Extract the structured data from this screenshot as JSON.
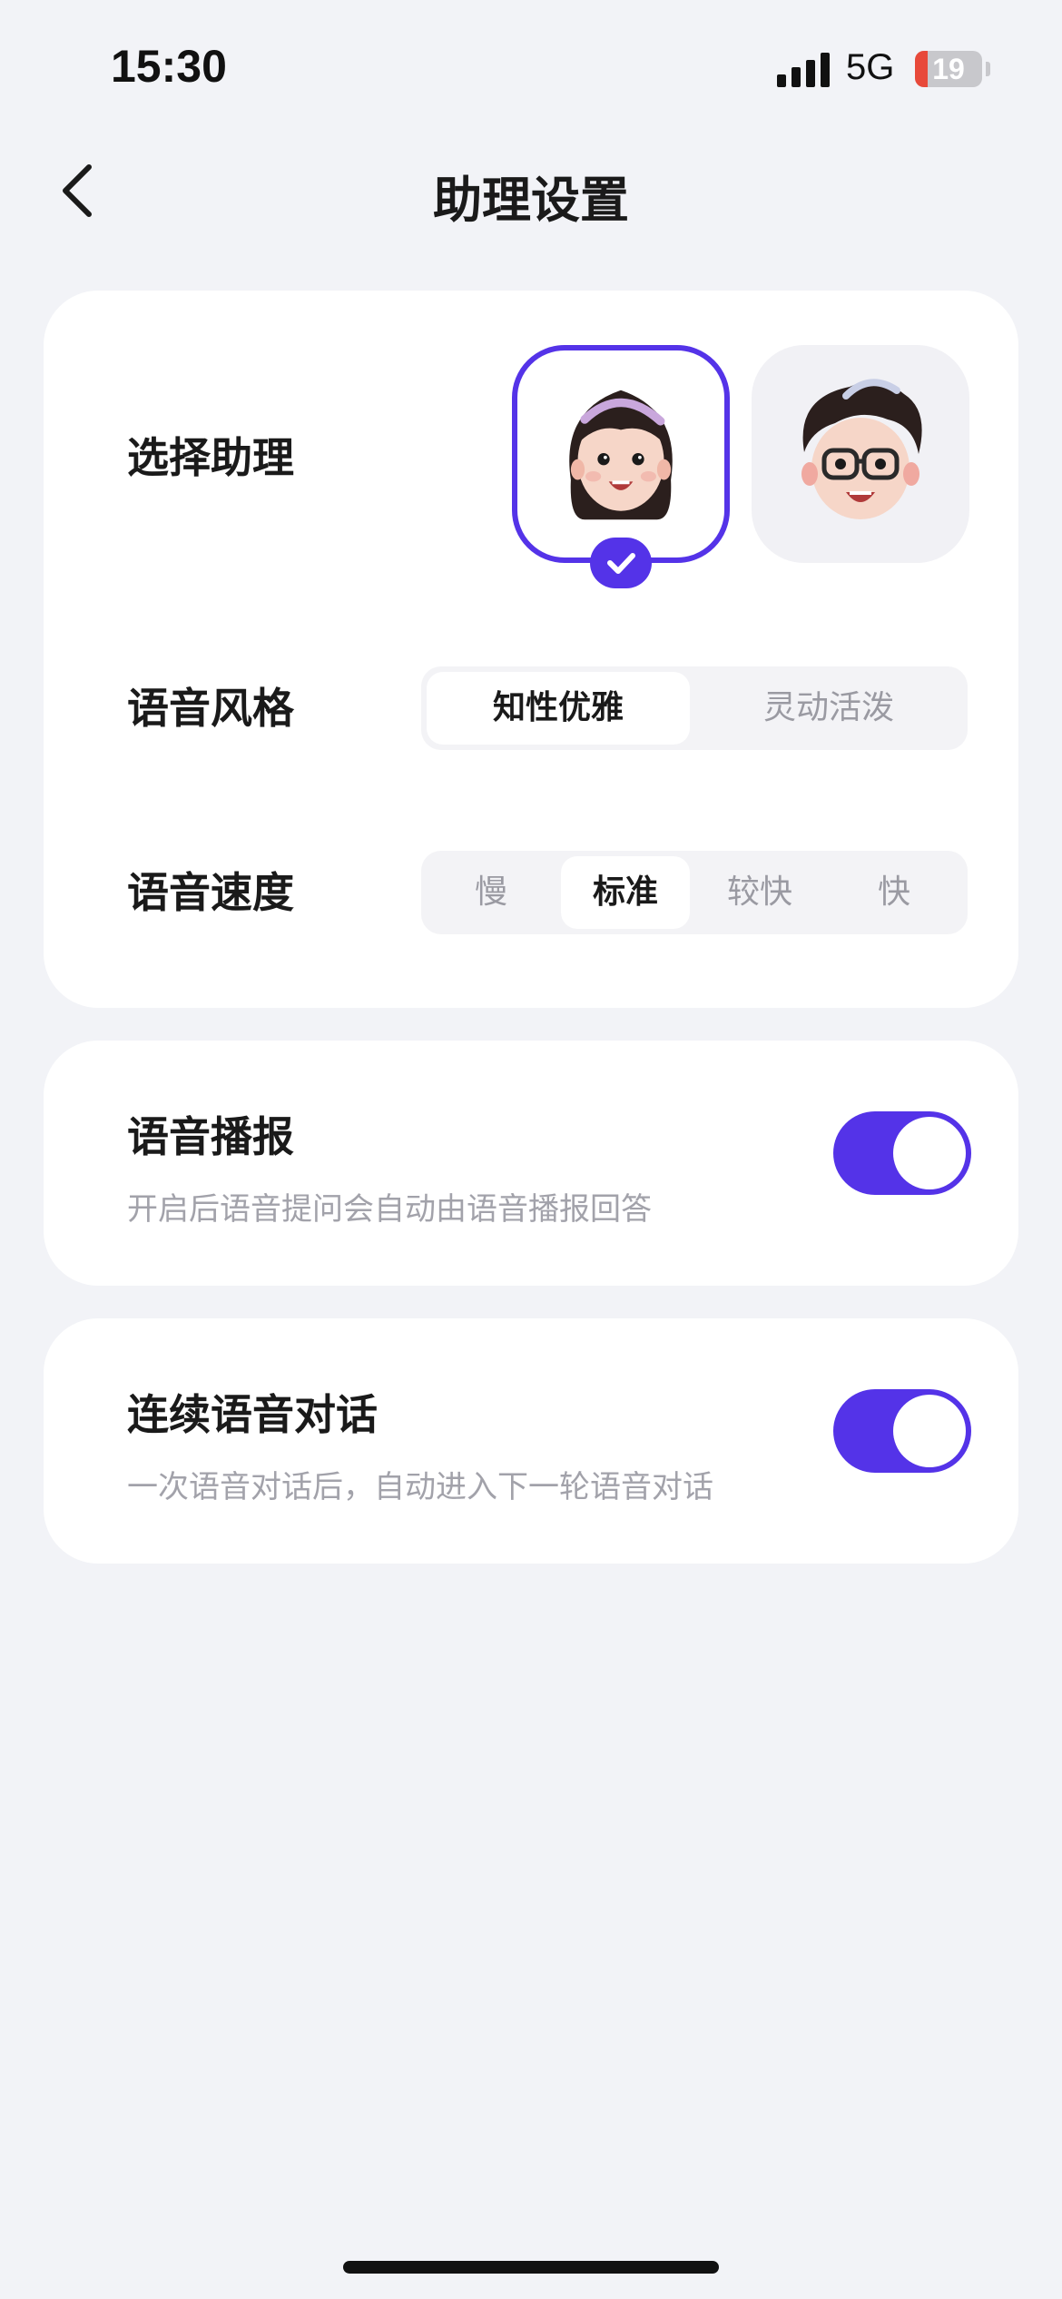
{
  "status_bar": {
    "time": "15:30",
    "network": "5G",
    "battery_level": "19",
    "battery_fraction": 0.19
  },
  "header": {
    "title": "助理设置",
    "back_icon": "chevron-left-icon"
  },
  "assistant_card": {
    "select_label": "选择助理",
    "assistants": [
      {
        "icon": "female-avatar-icon",
        "selected": true
      },
      {
        "icon": "male-avatar-icon",
        "selected": false
      }
    ],
    "style_label": "语音风格",
    "style_options": [
      "知性优雅",
      "灵动活泼"
    ],
    "style_selected": "知性优雅",
    "speed_label": "语音速度",
    "speed_options": [
      "慢",
      "标准",
      "较快",
      "快"
    ],
    "speed_selected": "标准"
  },
  "voice_broadcast": {
    "title": "语音播报",
    "description": "开启后语音提问会自动由语音播报回答",
    "enabled": true
  },
  "continuous_dialog": {
    "title": "连续语音对话",
    "description": "一次语音对话后，自动进入下一轮语音对话",
    "enabled": true
  },
  "colors": {
    "accent": "#5433e8",
    "background": "#f2f3f7",
    "card": "#ffffff",
    "muted_text": "#a2a2aa"
  }
}
